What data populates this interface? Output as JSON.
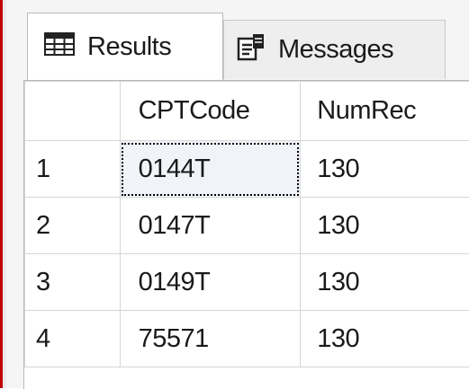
{
  "tabs": {
    "results_label": "Results",
    "messages_label": "Messages"
  },
  "grid": {
    "columns": [
      "",
      "CPTCode",
      "NumRec"
    ],
    "rows": [
      {
        "n": "1",
        "cpt": "0144T",
        "num": "130"
      },
      {
        "n": "2",
        "cpt": "0147T",
        "num": "130"
      },
      {
        "n": "3",
        "cpt": "0149T",
        "num": "130"
      },
      {
        "n": "4",
        "cpt": "75571",
        "num": "130"
      }
    ],
    "selected": {
      "row": 1,
      "column": "CPTCode"
    }
  },
  "icons": {
    "results": "grid-table-icon",
    "messages": "message-document-icon"
  },
  "colors": {
    "left_border": "#c00000",
    "selected_cell_bg": "#f0f4f8"
  }
}
